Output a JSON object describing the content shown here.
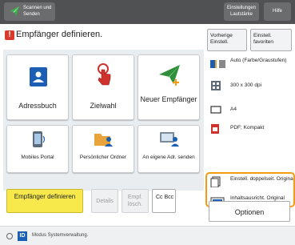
{
  "topbar": {
    "home_label": "Scannen und Senden",
    "settings_label": "Einstellungen Lautstärke",
    "help_label": "Hilfe"
  },
  "title": "Empfänger definieren.",
  "tiles": {
    "addressbook": "Adressbuch",
    "speeddial": "Zielwahl",
    "new_recipient": "Neuer Empfänger",
    "mobile_portal": "Mobiles Portal",
    "personal_folder": "Persönlicher Ordner",
    "send_to_self": "An eigene Adr. senden"
  },
  "actions": {
    "define": "Empfänger definieren",
    "details": "Details",
    "delete": "Empf. lösch.",
    "ccbcc": "Cc Bcc"
  },
  "side": {
    "prev_settings": "Vorherige Einstell.",
    "favorites": "Einstell. favoriten",
    "items": [
      {
        "icon": "color-mode-icon",
        "text": "Auto (Farbe/Graustufen)"
      },
      {
        "icon": "resolution-icon",
        "text": "300 x 300 dpi"
      },
      {
        "icon": "paper-size-icon",
        "text": "A4"
      },
      {
        "icon": "file-format-icon",
        "text": "PDF; Kompakt"
      },
      {
        "icon": "duplex-original-icon",
        "text": "Einstell. doppelseit. Original"
      },
      {
        "icon": "content-orientation-icon",
        "text": "Inhaltsausricht. Original"
      }
    ],
    "options": "Optionen"
  },
  "status": {
    "text": "Modus Systemverwaltung."
  },
  "colors": {
    "topbar": "#4f5152",
    "accent_yellow": "#f7e94c",
    "highlight_orange": "#f39c12",
    "warning_red": "#d93a2b",
    "tile_blue": "#1a5fb4",
    "speeddial_red": "#d0312d",
    "newrecip_green": "#2f8f3a"
  }
}
